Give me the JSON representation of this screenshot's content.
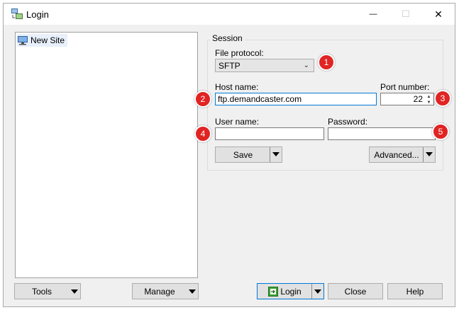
{
  "window": {
    "title": "Login",
    "controls": {
      "minimize": "—",
      "maximize": "☐",
      "close": "✕"
    }
  },
  "sidebar": {
    "tree": [
      {
        "label": "New Site"
      }
    ]
  },
  "session": {
    "group_title": "Session",
    "file_protocol": {
      "label": "File protocol:",
      "value": "SFTP"
    },
    "host_name": {
      "label": "Host name:",
      "value": "ftp.demandcaster.com"
    },
    "port_number": {
      "label": "Port number:",
      "value": "22"
    },
    "user_name": {
      "label": "User name:",
      "value": ""
    },
    "password": {
      "label": "Password:",
      "value": ""
    },
    "save_button": "Save",
    "advanced_button": "Advanced..."
  },
  "footer": {
    "tools_button": "Tools",
    "manage_button": "Manage",
    "login_button": "Login",
    "close_button": "Close",
    "help_button": "Help"
  },
  "callouts": [
    "1",
    "2",
    "3",
    "4",
    "5"
  ],
  "colors": {
    "callout": "#e02424",
    "focus_border": "#0078d7",
    "selected_item": "#e8f0fb"
  }
}
